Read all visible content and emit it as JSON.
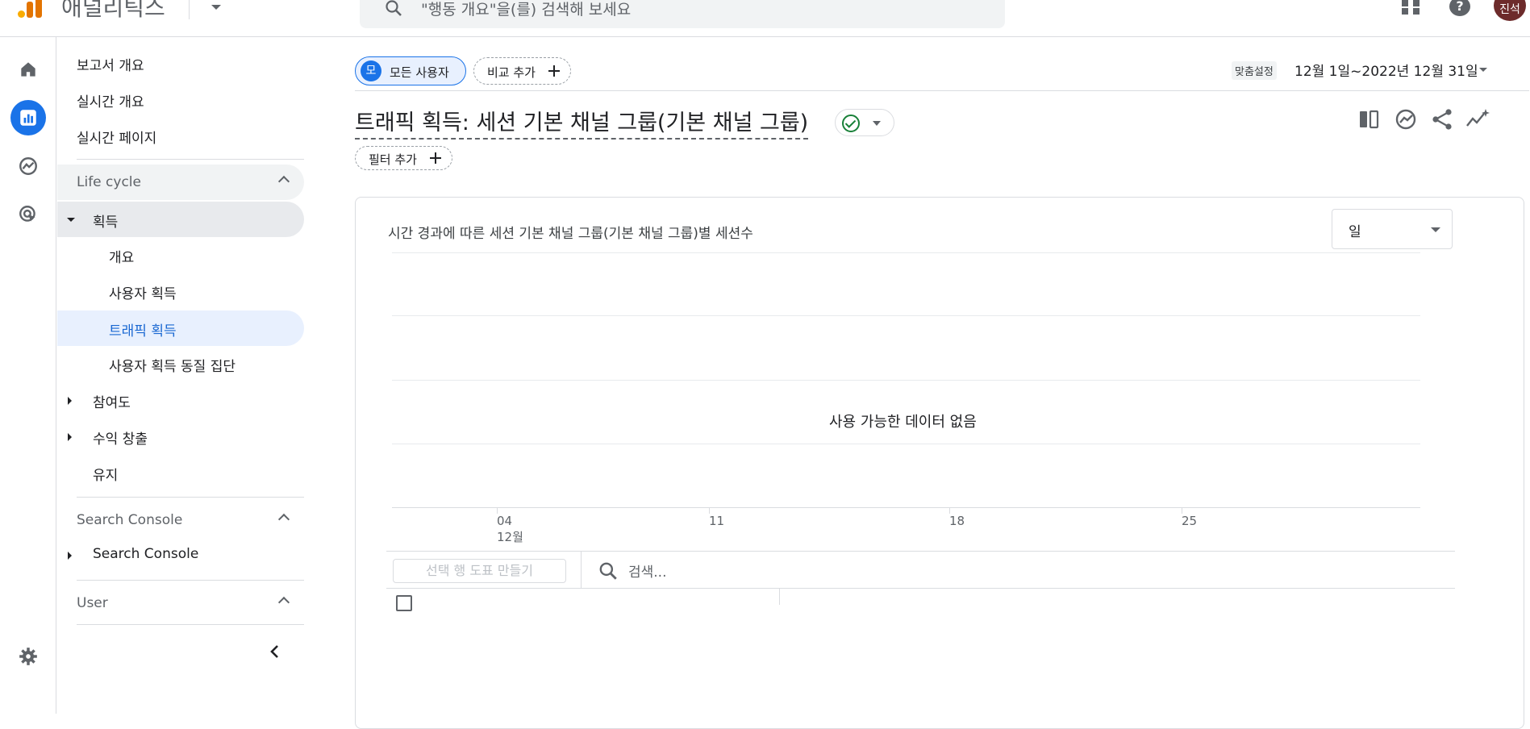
{
  "app": {
    "product_name": "애널리틱스",
    "search_placeholder": "\"행동 개요\"을(를) 검색해 보세요",
    "avatar_initials": "진석"
  },
  "nav": {
    "top_items": [
      "보고서 개요",
      "실시간 개요",
      "실시간 페이지"
    ],
    "lifecycle": {
      "label": "Life cycle",
      "acquisition": {
        "label": "획득",
        "children": [
          "개요",
          "사용자 획득",
          "트래픽 획득",
          "사용자 획득 동질 집단"
        ],
        "selected": "트래픽 획득"
      },
      "engagement": "참여도",
      "monetization": "수익 창출",
      "retention": "유지"
    },
    "search_console": {
      "label": "Search Console",
      "item": "Search Console"
    },
    "user": {
      "label": "User"
    }
  },
  "header": {
    "segment_chip": "모든 사용자",
    "segment_avatar": "모",
    "add_comparison": "비교 추가",
    "date_tag": "맞춤설정",
    "date_range": "12월 1일~2022년 12월 31일",
    "title": "트래픽 획득: 세션 기본 채널 그룹(기본 채널 그룹)",
    "add_filter": "필터 추가"
  },
  "chart_card": {
    "title": "시간 경과에 따른 세션 기본 채널 그룹(기본 채널 그룹)별 세션수",
    "granularity": "일",
    "no_data": "사용 가능한 데이터 없음",
    "x_ticks": [
      "04",
      "11",
      "18",
      "25"
    ],
    "x_month": "12월"
  },
  "table": {
    "plot_rows_button": "선택 행 도표 만들기",
    "search_placeholder": "검색..."
  },
  "colors": {
    "accent": "#1a73e8",
    "ok_green": "#188038"
  }
}
